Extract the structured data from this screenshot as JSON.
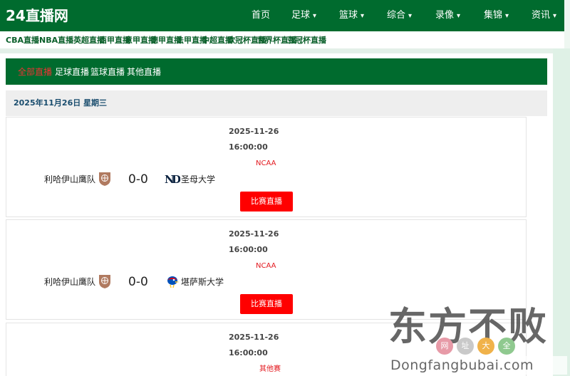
{
  "site": {
    "logo": "24直播网"
  },
  "nav": [
    {
      "label": "首页",
      "caret": ""
    },
    {
      "label": "足球",
      "caret": "▾"
    },
    {
      "label": "篮球",
      "caret": "▾"
    },
    {
      "label": "综合",
      "caret": "▾"
    },
    {
      "label": "录像",
      "caret": "▾"
    },
    {
      "label": "集锦",
      "caret": "▾"
    },
    {
      "label": "资讯",
      "caret": "▾"
    }
  ],
  "subnav": [
    "CBA直播",
    "NBA直播",
    "英超直播",
    "西甲直播",
    "意甲直播",
    "德甲直播",
    "法甲直播",
    "中超直播",
    "欧冠杯直播",
    "世界杯直播",
    "亚冠杯直播"
  ],
  "tabs": [
    "全部直播",
    "足球直播",
    "篮球直播",
    "其他直播"
  ],
  "active_tab": 0,
  "date_header": "2025年11月26日 星期三",
  "matches": [
    {
      "date": "2025-11-26",
      "time": "16:00:00",
      "league": "NCAA",
      "home": "利哈伊山鹰队",
      "score": "0-0",
      "away": "圣母大学",
      "button": "比赛直播"
    },
    {
      "date": "2025-11-26",
      "time": "16:00:00",
      "league": "NCAA",
      "home": "利哈伊山鹰队",
      "score": "0-0",
      "away": "堪萨斯大学",
      "button": "比赛直播"
    },
    {
      "date": "2025-11-26",
      "time": "16:00:00",
      "league": "其他赛",
      "home": "",
      "score": "",
      "away": "",
      "button": ""
    }
  ],
  "watermark": {
    "big": "东方不败",
    "circles": [
      {
        "text": "网",
        "color": "#e79aa7"
      },
      {
        "text": "址",
        "color": "#c9c9c9"
      },
      {
        "text": "大",
        "color": "#f0b24a"
      },
      {
        "text": "全",
        "color": "#8fc98f"
      }
    ],
    "url": "Dongfangbubai.com"
  },
  "colors": {
    "primary": "#006b2e",
    "accent": "#ff0000",
    "league": "#e3191f"
  }
}
